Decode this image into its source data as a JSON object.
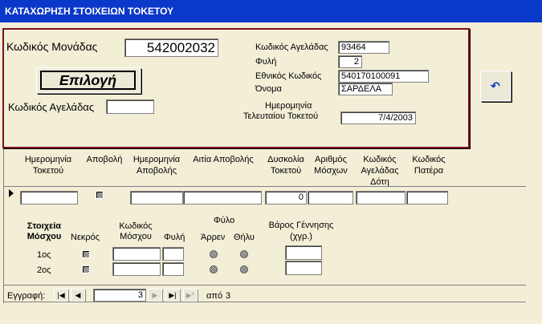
{
  "window": {
    "title": "ΚΑΤΑΧΩΡΗΣΗ ΣΤΟΙΧΕΙΩΝ ΤΟΚΕΤΟΥ"
  },
  "top": {
    "unit_code_label": "Κωδικός Μονάδας",
    "unit_code_value": "542002032",
    "select_button": "Επιλογή",
    "cow_code_label": "Κωδικός Αγελάδας",
    "cow_code_value": "",
    "info": {
      "cow_code_label": "Κωδικός Αγελάδας",
      "cow_code_value": "93464",
      "breed_label": "Φυλή",
      "breed_value": "2",
      "national_code_label": "Εθνικός Κωδικός",
      "national_code_value": "540170100091",
      "name_label": "Όνομα",
      "name_value": "ΣΑΡΔΕΛΑ",
      "last_birth_label_1": "Ημερομηνία",
      "last_birth_label_2": "Τελευταίου Τοκετού",
      "last_birth_value": "7/4/2003"
    },
    "undo_icon": "undo-arrow-icon"
  },
  "grid": {
    "headers": [
      "Ημερομηνία Τοκετού",
      "Αποβολή",
      "Ημερομηνία Αποβολής",
      "Αιτία Αποβολής",
      "Δυσκολία Τοκετού",
      "Αριθμός Μόσχων",
      "Κωδικός Αγελάδας Δότη",
      "Κωδικός Πατέρα"
    ],
    "row": {
      "birth_date": "",
      "abortion_date": "",
      "abortion_cause": "",
      "difficulty": "0",
      "calves_count": "",
      "donor_code": "",
      "father_code": ""
    },
    "record_selector_icon": "current-record-arrow-icon"
  },
  "calves": {
    "section_label": "Στοιχεία Μόσχου",
    "dead_label": "Νεκρός",
    "code_label": "Κωδικός Μόσχου",
    "breed_label": "Φυλή",
    "sex_label": "Φύλο",
    "male_label": "Άρρεν",
    "female_label": "Θήλυ",
    "weight_label": "Βάρος Γέννησης (χγρ.)",
    "rows": [
      {
        "label": "1ος",
        "code": "",
        "breed": "",
        "weight": ""
      },
      {
        "label": "2ος",
        "code": "",
        "breed": "",
        "weight": ""
      }
    ]
  },
  "nav": {
    "record_label": "Εγγραφή:",
    "current": "3",
    "of_label": "από",
    "total": "3",
    "first_icon": "first-record-icon",
    "prev_icon": "prev-record-icon",
    "next_icon": "next-record-icon",
    "last_icon": "last-record-icon",
    "new_icon": "new-record-icon"
  }
}
